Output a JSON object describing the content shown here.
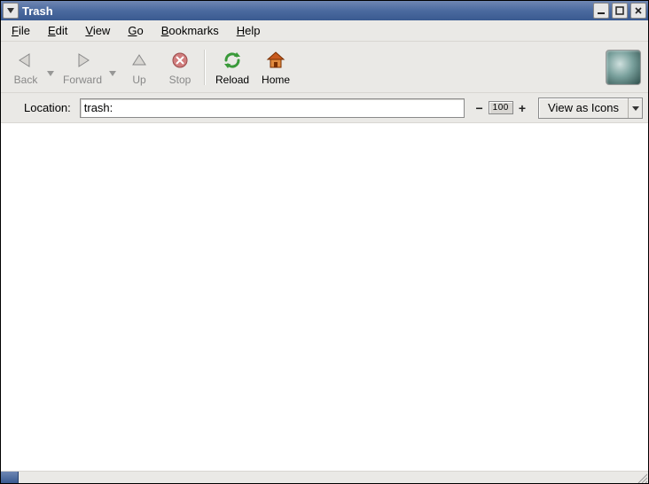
{
  "window": {
    "title": "Trash"
  },
  "menu": {
    "file": {
      "accel": "F",
      "rest": "ile"
    },
    "edit": {
      "accel": "E",
      "rest": "dit"
    },
    "view": {
      "accel": "V",
      "rest": "iew"
    },
    "go": {
      "accel": "G",
      "rest": "o"
    },
    "bookmarks": {
      "accel": "B",
      "rest": "ookmarks"
    },
    "help": {
      "accel": "H",
      "rest": "elp"
    }
  },
  "toolbar": {
    "back": "Back",
    "forward": "Forward",
    "up": "Up",
    "stop": "Stop",
    "reload": "Reload",
    "home": "Home"
  },
  "location": {
    "label": "Location:",
    "value": "trash:"
  },
  "zoom": {
    "minus": "−",
    "value": "100",
    "plus": "+"
  },
  "view_mode": {
    "label": "View as Icons"
  }
}
